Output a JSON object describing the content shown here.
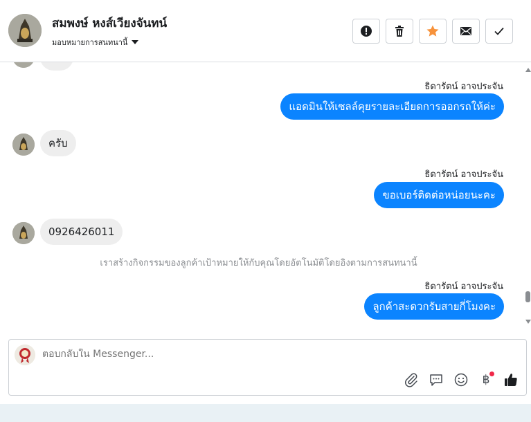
{
  "header": {
    "contact_name": "สมพงษ์ หงส์เวียงจันทน์",
    "assign_label": "มอบหมายการสนทนานี้",
    "actions": [
      {
        "name": "mark-spam-button",
        "icon": "alert-icon"
      },
      {
        "name": "delete-button",
        "icon": "trash-icon"
      },
      {
        "name": "star-button",
        "icon": "star-icon",
        "color": "#f7923b"
      },
      {
        "name": "mark-unread-button",
        "icon": "mail-icon"
      },
      {
        "name": "mark-done-button",
        "icon": "check-icon"
      }
    ]
  },
  "thread": {
    "messages": [
      {
        "type": "outgoing",
        "sender": "ธิดารัตน์ อาจประจัน",
        "text": "แอดมินให้เซลล์คุยรายละเอียดการออกรถให้ค่ะ"
      },
      {
        "type": "incoming",
        "text": "ครับ"
      },
      {
        "type": "outgoing",
        "sender": "ธิดารัตน์ อาจประจัน",
        "text": "ขอเบอร์ติดต่อหน่อยนะคะ"
      },
      {
        "type": "incoming",
        "text": "0926426011"
      },
      {
        "type": "system",
        "text": "เราสร้างกิจกรรมของลูกค้าเป้าหมายให้กับคุณโดยอัตโนมัติโดยอิงตามการสนทนานี้"
      },
      {
        "type": "outgoing",
        "sender": "ธิดารัตน์ อาจประจัน",
        "text": "ลูกค้าสะดวกรับสายกี่โมงคะ"
      }
    ]
  },
  "composer": {
    "placeholder": "ตอบกลับใน Messenger...",
    "tools": [
      "paperclip-icon",
      "saved-reply-icon",
      "emoji-icon",
      "baht-payment-icon",
      "like-icon"
    ],
    "baht_symbol": "฿"
  },
  "colors": {
    "outgoing_bubble": "#0b84ff",
    "incoming_bubble": "#eeeeee",
    "accent_star": "#f7923b",
    "notification_dot": "#f02849"
  }
}
